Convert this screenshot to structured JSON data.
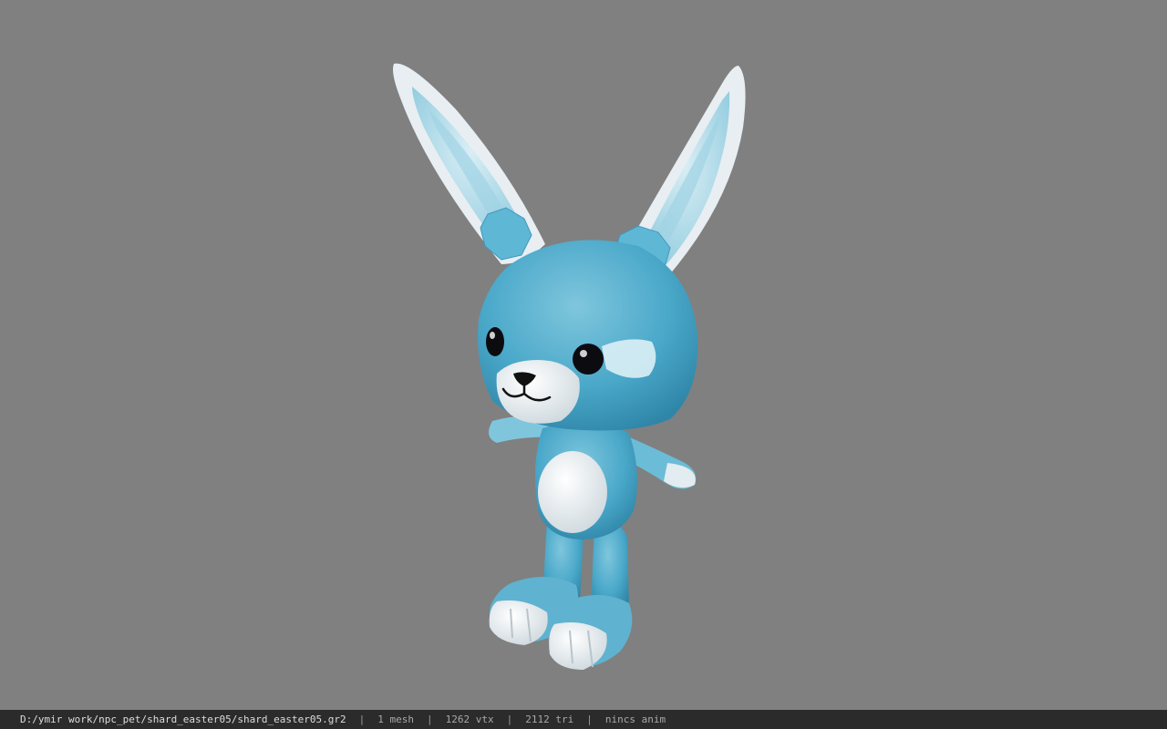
{
  "viewer": {
    "background_color": "#808080",
    "model_icon": "bunny-model",
    "model_colors": {
      "fur": "#4aa8c9",
      "fur_light": "#7fc6dd",
      "belly": "#f2f4f5",
      "eye": "#0c0c10"
    }
  },
  "status_bar": {
    "file_path": "D:/ymir work/npc_pet/shard_easter05/shard_easter05.gr2",
    "separator": "|",
    "mesh_count": "1 mesh",
    "vertex_count": "1262 vtx",
    "triangle_count": "2112 tri",
    "animation": "nincs anim"
  }
}
